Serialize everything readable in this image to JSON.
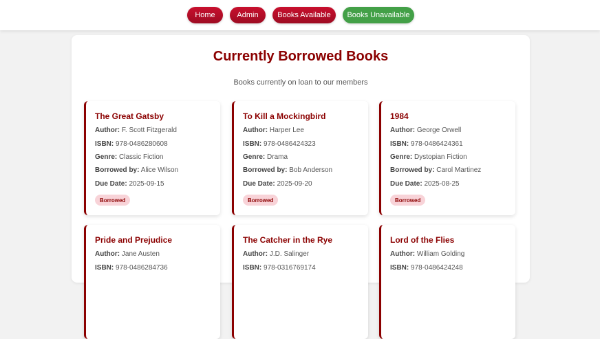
{
  "nav": {
    "home": "Home",
    "admin": "Admin",
    "books_available": "Books Available",
    "books_unavailable": "Books Unavailable"
  },
  "page": {
    "title": "Currently Borrowed Books",
    "subtitle": "Books currently on loan to our members"
  },
  "labels": {
    "author": "Author:",
    "isbn": "ISBN:",
    "genre": "Genre:",
    "borrowed_by": "Borrowed by:",
    "due_date": "Due Date:"
  },
  "books": [
    {
      "title": "The Great Gatsby",
      "author": "F. Scott Fitzgerald",
      "isbn": "978-0486280608",
      "genre": "Classic Fiction",
      "borrowed_by": "Alice Wilson",
      "due_date": "2025-09-15",
      "status": "Borrowed"
    },
    {
      "title": "To Kill a Mockingbird",
      "author": "Harper Lee",
      "isbn": "978-0486424323",
      "genre": "Drama",
      "borrowed_by": "Bob Anderson",
      "due_date": "2025-09-20",
      "status": "Borrowed"
    },
    {
      "title": "1984",
      "author": "George Orwell",
      "isbn": "978-0486424361",
      "genre": "Dystopian Fiction",
      "borrowed_by": "Carol Martinez",
      "due_date": "2025-08-25",
      "status": "Borrowed"
    },
    {
      "title": "Pride and Prejudice",
      "author": "Jane Austen",
      "isbn": "978-0486284736"
    },
    {
      "title": "The Catcher in the Rye",
      "author": "J.D. Salinger",
      "isbn": "978-0316769174"
    },
    {
      "title": "Lord of the Flies",
      "author": "William Golding",
      "isbn": "978-0486424248"
    }
  ],
  "colors": {
    "primary": "#8b0000",
    "nav_red": "#c8102e",
    "nav_green": "#43a047",
    "badge_bg": "#f8d3d8"
  }
}
